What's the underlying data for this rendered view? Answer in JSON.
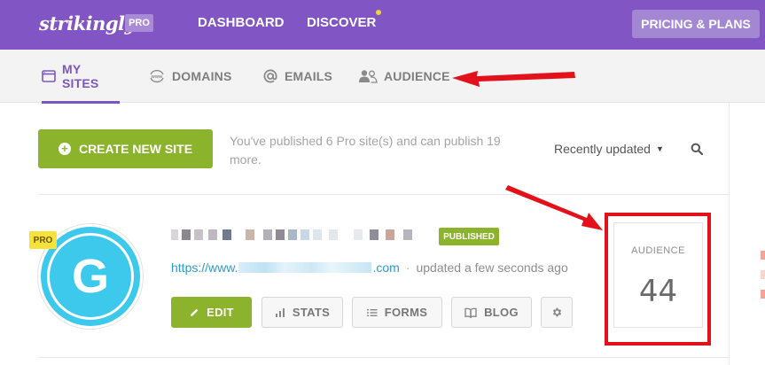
{
  "header": {
    "logo": "strikingly",
    "plan_badge": "PRO",
    "nav": [
      {
        "label": "DASHBOARD"
      },
      {
        "label": "DISCOVER",
        "has_notification": true
      }
    ],
    "pricing_button": "PRICING & PLANS",
    "colors": {
      "brand": "#8155c3",
      "notification_dot": "#f4d03f"
    }
  },
  "subnav": {
    "tabs": [
      {
        "label": "MY SITES",
        "icon": "browser-window-icon",
        "active": true
      },
      {
        "label": "DOMAINS",
        "icon": "www-globe-icon",
        "active": false
      },
      {
        "label": "EMAILS",
        "icon": "at-sign-icon",
        "active": false
      },
      {
        "label": "AUDIENCE",
        "icon": "people-icon",
        "active": false
      }
    ],
    "active_color": "#7e56c2"
  },
  "toolbar": {
    "create_button": "CREATE NEW SITE",
    "publish_note": "You've published 6 Pro site(s) and can publish 19 more.",
    "sort_label": "Recently updated",
    "sort_caret": "▼",
    "search_icon": "search-icon"
  },
  "site": {
    "badge": "PRO",
    "avatar_letter": "G",
    "avatar_color": "#3dc9ec",
    "status": "PUBLISHED",
    "url_prefix": "https://www.",
    "url_suffix": ".com",
    "separator": "·",
    "updated": "updated a few seconds ago",
    "actions": [
      {
        "label": "EDIT",
        "icon": "pencil-icon"
      },
      {
        "label": "STATS",
        "icon": "bar-chart-icon"
      },
      {
        "label": "FORMS",
        "icon": "list-icon"
      },
      {
        "label": "BLOG",
        "icon": "book-icon"
      },
      {
        "label": "",
        "icon": "gear-icon"
      }
    ],
    "audience_label": "AUDIENCE",
    "audience_count": "44"
  },
  "annotations": {
    "highlight_color": "#e3111a"
  }
}
